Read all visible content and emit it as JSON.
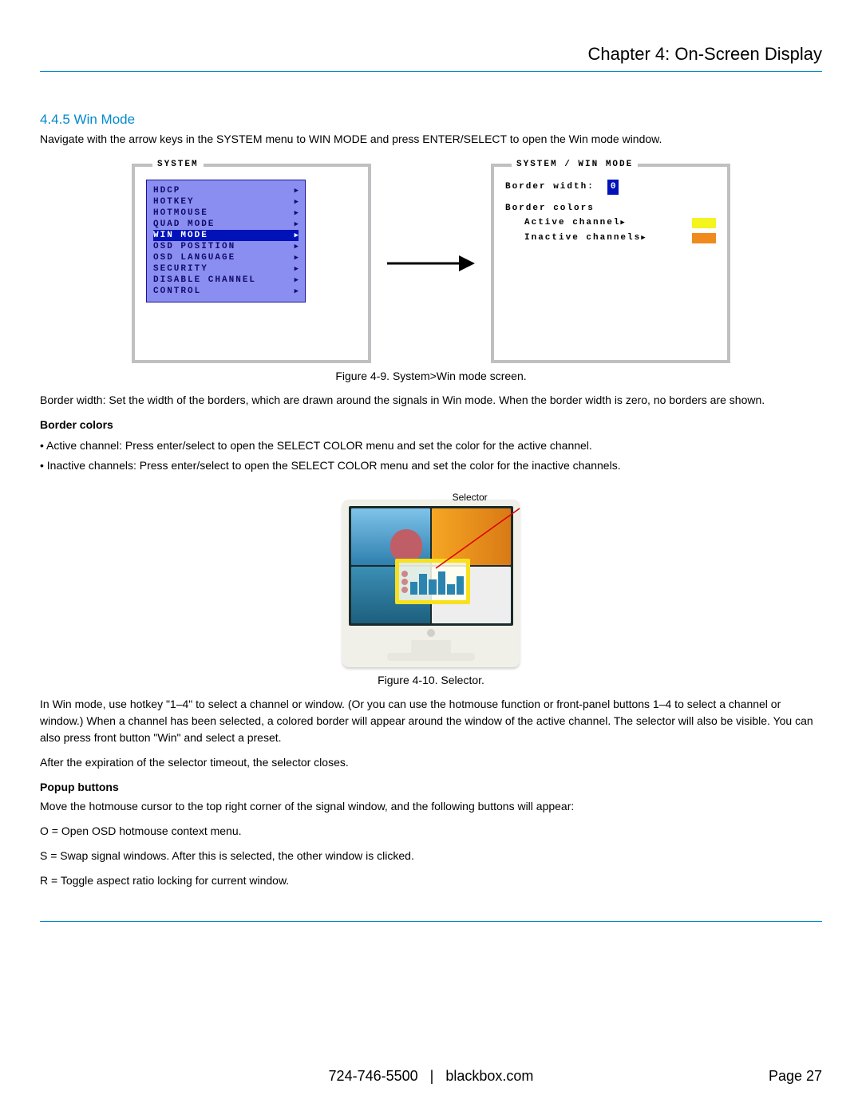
{
  "header": {
    "chapter": "Chapter 4: On-Screen Display"
  },
  "section": {
    "number_title": "4.4.5 Win Mode",
    "intro": "Navigate with the arrow keys in the SYSTEM menu to WIN MODE and press ENTER/SELECT to open the Win mode window."
  },
  "osd_left": {
    "title": "SYSTEM",
    "items": [
      "HDCP",
      "HOTKEY",
      "HOTMOUSE",
      "QUAD MODE",
      "WIN MODE",
      "OSD POSITION",
      "OSD LANGUAGE",
      "SECURITY",
      "DISABLE CHANNEL",
      "CONTROL"
    ],
    "selected_index": 4
  },
  "osd_right": {
    "title": "SYSTEM / WIN MODE",
    "border_width_label": "Border width:",
    "border_width_value": "0",
    "border_colors_label": "Border colors",
    "active_label": "Active channel",
    "inactive_label": "Inactive channels",
    "active_color": "#f4f420",
    "inactive_color": "#f08a1d"
  },
  "fig9_caption": "Figure 4-9. System>Win mode screen.",
  "border_width_para": "Border width: Set the width of the borders, which are drawn around the signals in Win mode. When the border width is zero, no borders are shown.",
  "border_colors_heading": "Border colors",
  "bullet_active": "• Active channel: Press enter/select to open the SELECT COLOR menu and set the color for the active channel.",
  "bullet_inactive": "• Inactive channels: Press enter/select to open the SELECT COLOR menu and set the color for the inactive channels.",
  "selector_label": "Selector",
  "fig10_caption": "Figure 4-10. Selector.",
  "para_winmode": "In Win mode, use hotkey \"1–4\" to select a channel or window. (Or you can use the hotmouse function or front-panel buttons 1–4 to select a channel or window.) When a channel has been selected, a colored border will appear around the window of the active channel. The selector will also be visible. You can also press front button \"Win\" and select a preset.",
  "para_timeout": "After the expiration of the selector timeout, the selector closes.",
  "popup_heading": "Popup buttons",
  "popup_intro": "Move the hotmouse cursor to the top right corner of the signal window, and the following buttons will appear:",
  "popup_O": "O = Open OSD hotmouse context menu.",
  "popup_S": "S = Swap signal windows. After this is selected, the other window is clicked.",
  "popup_R": "R = Toggle aspect ratio locking for current window.",
  "footer": {
    "phone": "724-746-5500",
    "sep": "|",
    "site": "blackbox.com",
    "page": "Page 27"
  }
}
